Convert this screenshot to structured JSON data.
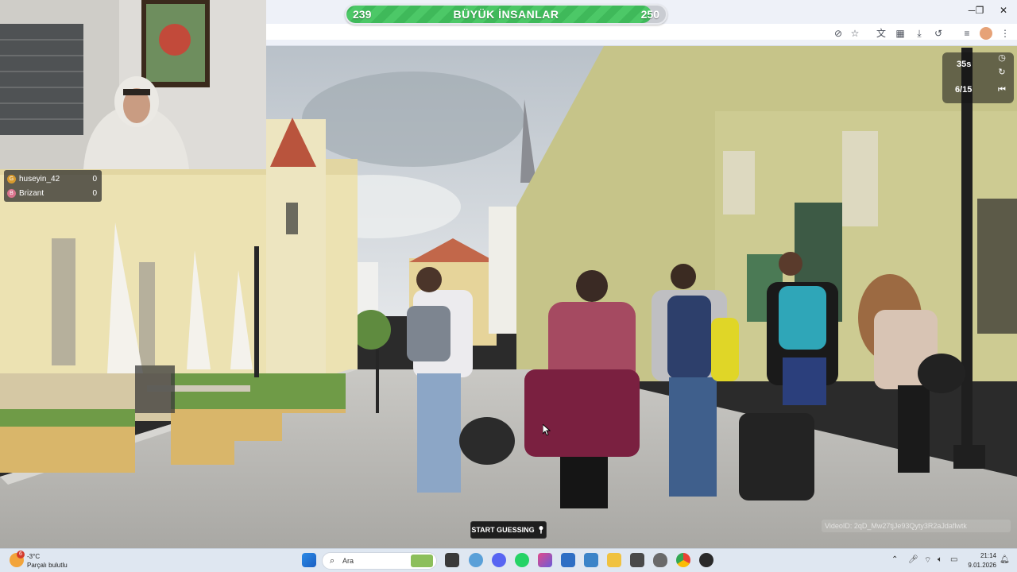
{
  "progress": {
    "left_value": "239",
    "right_value": "250",
    "title": "BÜYÜK İNSANLAR",
    "fill_fraction": 0.956,
    "color": "#3fb95a"
  },
  "scoreboard": {
    "players": [
      {
        "badge": "G",
        "name": "huseyin_42",
        "score": "0",
        "color": "#d79a2e"
      },
      {
        "badge": "B",
        "name": "Brizant",
        "score": "0",
        "color": "#d9738c"
      }
    ]
  },
  "game": {
    "timer": "35s",
    "round": "6/15",
    "start_button": "START GUESSING",
    "video_id": "VideoID: 2qD_Mw27tjJe93Qyty3R2aJdaflwtk"
  },
  "browser": {
    "icons": [
      "eye-off-icon",
      "star-icon",
      "translate-icon",
      "apps-icon",
      "download-icon",
      "history-icon",
      "reading-list-icon",
      "profile-avatar",
      "more-icon"
    ],
    "window_controls": [
      "minimize",
      "restore",
      "close"
    ]
  },
  "taskbar": {
    "weather_badge": "6",
    "temperature": "-3°C",
    "condition": "Parçalı bulutlu",
    "search_placeholder": "Ara",
    "time": "21:14",
    "date": "9.01.2026"
  }
}
